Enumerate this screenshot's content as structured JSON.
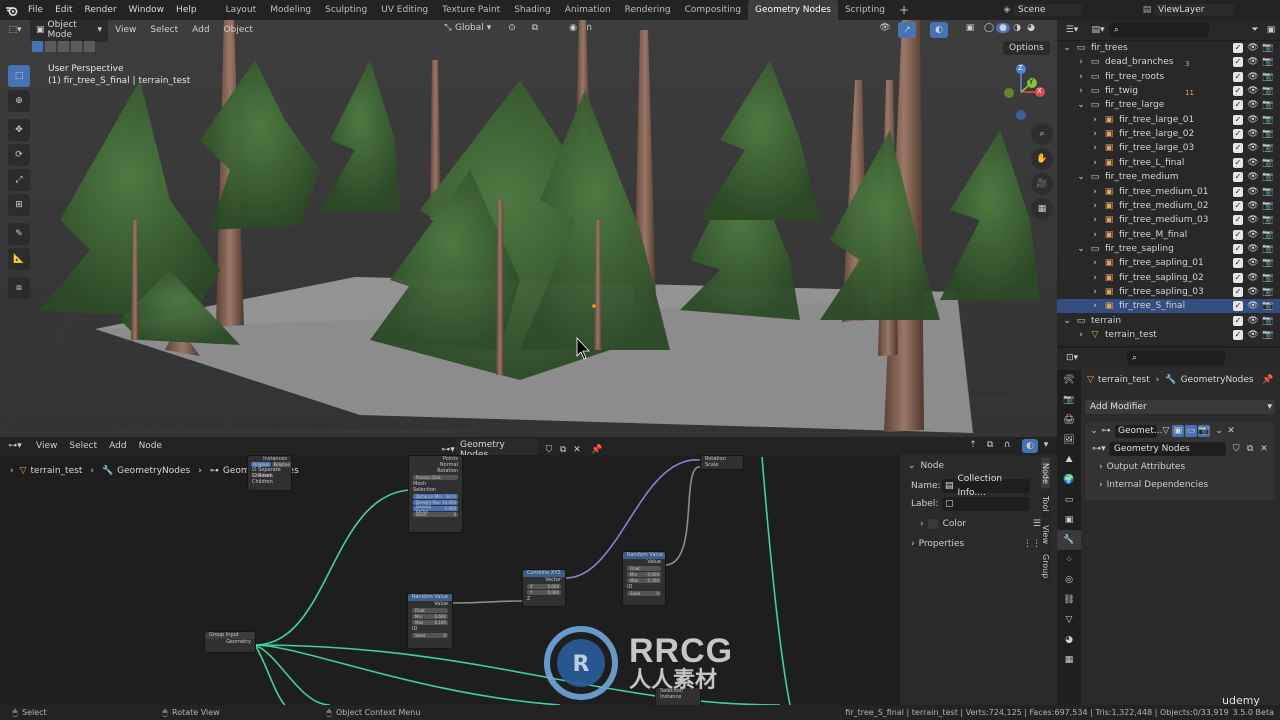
{
  "topbar": {
    "menus": [
      "File",
      "Edit",
      "Render",
      "Window",
      "Help"
    ],
    "workspaces": [
      "Layout",
      "Modeling",
      "Sculpting",
      "UV Editing",
      "Texture Paint",
      "Shading",
      "Animation",
      "Rendering",
      "Compositing",
      "Geometry Nodes",
      "Scripting"
    ],
    "active_workspace": "Geometry Nodes",
    "add_tab": "+",
    "scene": "Scene",
    "view_layer": "ViewLayer"
  },
  "viewport": {
    "mode": "Object Mode",
    "menus": [
      "View",
      "Select",
      "Add",
      "Object"
    ],
    "orientation": "Global",
    "options": "Options",
    "perspective": "User Perspective",
    "object_info": "(1) fir_tree_S_final | terrain_test",
    "gizmo": {
      "z": "Z",
      "y": "Y",
      "x": "X"
    }
  },
  "node_editor": {
    "menus": [
      "View",
      "Select",
      "Add",
      "Node"
    ],
    "tree_name": "Geometry Nodes",
    "breadcrumb": [
      "terrain_test",
      "GeometryNodes",
      "Geometry Nodes"
    ],
    "nodes": {
      "collection_info": {
        "opt1": "Original",
        "opt2": "Relative",
        "c1": "Separate Children",
        "c2": "Reset Children",
        "top": "Instances"
      },
      "distribute": {
        "out1": "Points",
        "out2": "Normal",
        "out3": "Rotation",
        "mode": "Poisson Disk",
        "in1": "Mesh",
        "in2": "Selection",
        "f1": "Distance Min",
        "f1v": "28 m",
        "f2": "Density Max",
        "f2v": "10.000",
        "f3": "Density Factor",
        "f3v": "1.000",
        "f4": "Seed",
        "f4v": "0"
      },
      "combine": {
        "title": "Combine XYZ",
        "out": "Vector",
        "x": "X",
        "xv": "0.000",
        "y": "Y",
        "yv": "0.000",
        "z": "Z"
      },
      "random1": {
        "title": "Random Value",
        "out": "Value",
        "type": "Float",
        "min": "Min",
        "minv": "0.600",
        "max": "Max",
        "maxv": "0.100",
        "id": "ID",
        "seed": "Seed",
        "seedv": "0"
      },
      "random2": {
        "title": "Random Value",
        "out": "Value",
        "type": "Float",
        "min": "Min",
        "minv": "0.600",
        "max": "Max",
        "maxv": "0.700",
        "id": "ID",
        "seed": "Seed",
        "seedv": "0"
      },
      "rotation": {
        "r": "Rotation",
        "s": "Scale"
      },
      "group_input": {
        "title": "Group Input",
        "out": "Geometry"
      },
      "bottom": {
        "a": "Selection",
        "b": "Instance"
      }
    }
  },
  "side_panel": {
    "tabs": [
      "Node",
      "Tool",
      "View",
      "Group"
    ],
    "section": "Node",
    "name_label": "Name:",
    "name_value": "Collection Info....",
    "label_label": "Label:",
    "color": "Color",
    "properties": "Properties"
  },
  "outliner": {
    "rows": [
      {
        "label": "fir_trees",
        "depth": 1,
        "kind": "collection",
        "expanded": true
      },
      {
        "label": "dead_branches",
        "depth": 2,
        "kind": "collection",
        "badge": "3"
      },
      {
        "label": "fir_tree_roots",
        "depth": 2,
        "kind": "collection"
      },
      {
        "label": "fir_twig",
        "depth": 2,
        "kind": "collection",
        "badge": "11"
      },
      {
        "label": "fir_tree_large",
        "depth": 2,
        "kind": "collection",
        "expanded": true
      },
      {
        "label": "fir_tree_large_01",
        "depth": 3,
        "kind": "object"
      },
      {
        "label": "fir_tree_large_02",
        "depth": 3,
        "kind": "object"
      },
      {
        "label": "fir_tree_large_03",
        "depth": 3,
        "kind": "object"
      },
      {
        "label": "fir_tree_L_final",
        "depth": 3,
        "kind": "object"
      },
      {
        "label": "fir_tree_medium",
        "depth": 2,
        "kind": "collection",
        "expanded": true
      },
      {
        "label": "fir_tree_medium_01",
        "depth": 3,
        "kind": "object"
      },
      {
        "label": "fir_tree_medium_02",
        "depth": 3,
        "kind": "object"
      },
      {
        "label": "fir_tree_medium_03",
        "depth": 3,
        "kind": "object"
      },
      {
        "label": "fir_tree_M_final",
        "depth": 3,
        "kind": "object"
      },
      {
        "label": "fir_tree_sapling",
        "depth": 2,
        "kind": "collection",
        "expanded": true
      },
      {
        "label": "fir_tree_sapling_01",
        "depth": 3,
        "kind": "object"
      },
      {
        "label": "fir_tree_sapling_02",
        "depth": 3,
        "kind": "object"
      },
      {
        "label": "fir_tree_sapling_03",
        "depth": 3,
        "kind": "object"
      },
      {
        "label": "fir_tree_S_final",
        "depth": 3,
        "kind": "object",
        "selected": true
      },
      {
        "label": "terrain",
        "depth": 1,
        "kind": "collection",
        "expanded": true
      },
      {
        "label": "terrain_test",
        "depth": 2,
        "kind": "mesh"
      }
    ]
  },
  "properties": {
    "breadcrumb_object": "terrain_test",
    "breadcrumb_modifier": "GeometryNodes",
    "add_modifier": "Add Modifier",
    "modifier_name": "Geomet...",
    "node_group": "Geometry Nodes",
    "output_attributes": "Output Attributes",
    "internal_dependencies": "Internal Dependencies"
  },
  "statusbar": {
    "select": "Select",
    "rotate": "Rotate View",
    "context": "Object Context Menu",
    "stats": "fir_tree_S_final | terrain_test | Verts:724,125 | Faces:697,534 | Tris:1,322,448 | Objects:0/33,919",
    "version": "3.5.0 Beta"
  },
  "watermark": {
    "brand": "RRCG",
    "sub": "人人素材",
    "udemy": "udemy"
  },
  "colors": {
    "accent": "#4772b3",
    "link_green": "#3fd0a4",
    "link_purple": "#8a7fd6",
    "outliner_selected": "#334d80"
  }
}
